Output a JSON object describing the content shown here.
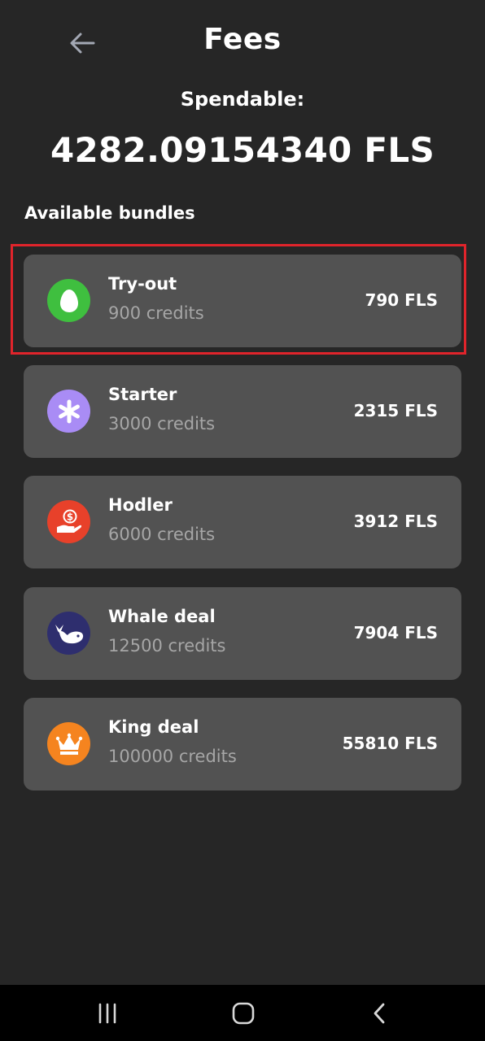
{
  "header": {
    "title": "Fees",
    "back_icon": "arrow-left-icon"
  },
  "balance": {
    "label": "Spendable:",
    "amount": "4282.09154340 FLS"
  },
  "bundles_section": {
    "title": "Available bundles",
    "items": [
      {
        "name": "Try-out",
        "credits": "900 credits",
        "price": "790 FLS",
        "icon": "egg-icon",
        "icon_color": "#3fbf3f",
        "selected": true
      },
      {
        "name": "Starter",
        "credits": "3000 credits",
        "price": "2315 FLS",
        "icon": "asterisk-icon",
        "icon_color": "#a98cf5",
        "selected": false
      },
      {
        "name": "Hodler",
        "credits": "6000 credits",
        "price": "3912 FLS",
        "icon": "money-hand-icon",
        "icon_color": "#e8412a",
        "selected": false
      },
      {
        "name": "Whale deal",
        "credits": "12500 credits",
        "price": "7904 FLS",
        "icon": "whale-icon",
        "icon_color": "#2e2e6e",
        "selected": false
      },
      {
        "name": "King deal",
        "credits": "100000 credits",
        "price": "55810 FLS",
        "icon": "crown-icon",
        "icon_color": "#f5841f",
        "selected": false
      }
    ]
  },
  "system_nav": {
    "recents_icon": "recent-apps-icon",
    "home_icon": "home-icon",
    "back_icon": "nav-back-icon"
  },
  "colors": {
    "background": "#262626",
    "card": "#525252",
    "highlight": "#e0242b",
    "muted_text": "#a6a6a6"
  }
}
